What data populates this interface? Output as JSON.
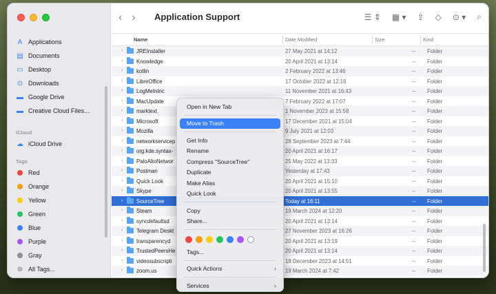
{
  "window": {
    "title": "Application Support"
  },
  "sidebar": {
    "favorites": [
      {
        "label": "Applications",
        "icon": "applications-icon"
      },
      {
        "label": "Documents",
        "icon": "document-icon"
      },
      {
        "label": "Desktop",
        "icon": "desktop-icon"
      },
      {
        "label": "Downloads",
        "icon": "downloads-icon"
      },
      {
        "label": "Google Drive",
        "icon": "folder-icon"
      },
      {
        "label": "Creative Cloud Files...",
        "icon": "folder-icon"
      }
    ],
    "icloud_heading": "iCloud",
    "icloud": [
      {
        "label": "iCloud Drive",
        "icon": "cloud-icon"
      }
    ],
    "tags_heading": "Tags",
    "tags": [
      {
        "label": "Red",
        "color": "#ef4444"
      },
      {
        "label": "Orange",
        "color": "#f59e0b"
      },
      {
        "label": "Yellow",
        "color": "#facc15"
      },
      {
        "label": "Green",
        "color": "#22c55e"
      },
      {
        "label": "Blue",
        "color": "#3b82f6"
      },
      {
        "label": "Purple",
        "color": "#a855f7"
      },
      {
        "label": "Gray",
        "color": "#8e8e93"
      },
      {
        "label": "All Tags...",
        "color": ""
      }
    ]
  },
  "columns": {
    "name": "Name",
    "date": "Date Modified",
    "size": "Size",
    "kind": "Kind"
  },
  "rows": [
    {
      "name": "JREInstaller",
      "date": "27 May 2021 at 14:12",
      "size": "--",
      "kind": "Folder"
    },
    {
      "name": "Knowledge",
      "date": "20 April 2021 at 13:14",
      "size": "--",
      "kind": "Folder"
    },
    {
      "name": "kotlin",
      "date": "2 February 2022 at 13:46",
      "size": "--",
      "kind": "Folder"
    },
    {
      "name": "LibreOffice",
      "date": "17 October 2022 at 12:16",
      "size": "--",
      "kind": "Folder"
    },
    {
      "name": "LogMeInInc",
      "date": "11 November 2021 at 16:43",
      "size": "--",
      "kind": "Folder"
    },
    {
      "name": "MacUpdate",
      "date": "7 February 2022 at 17:07",
      "size": "--",
      "kind": "Folder"
    },
    {
      "name": "marktext",
      "date": "1 November 2023 at 15:58",
      "size": "--",
      "kind": "Folder"
    },
    {
      "name": "Microsoft",
      "date": "17 December 2021 at 15:04",
      "size": "--",
      "kind": "Folder"
    },
    {
      "name": "Mozilla",
      "date": "9 July 2021 at 12:03",
      "size": "--",
      "kind": "Folder"
    },
    {
      "name": "networkservicep",
      "date": "28 September 2023 at 7:44",
      "size": "--",
      "kind": "Folder"
    },
    {
      "name": "org.kde.syntax-",
      "date": "20 April 2021 at 16:17",
      "size": "--",
      "kind": "Folder"
    },
    {
      "name": "PaloAltoNetwor",
      "date": "25 May 2022 at 13:33",
      "size": "--",
      "kind": "Folder"
    },
    {
      "name": "Postman",
      "date": "Yesterday at 17:43",
      "size": "--",
      "kind": "Folder"
    },
    {
      "name": "Quick Look",
      "date": "20 April 2021 at 15:10",
      "size": "--",
      "kind": "Folder"
    },
    {
      "name": "Skype",
      "date": "20 April 2021 at 13:55",
      "size": "--",
      "kind": "Folder"
    },
    {
      "name": "SourceTree",
      "date": "Today at 16:11",
      "size": "--",
      "kind": "Folder",
      "selected": true
    },
    {
      "name": "Steam",
      "date": "19 March 2024 at 12:20",
      "size": "--",
      "kind": "Folder"
    },
    {
      "name": "syncdefaultsd",
      "date": "20 April 2021 at 13:14",
      "size": "--",
      "kind": "Folder"
    },
    {
      "name": "Telegram Deskt",
      "date": "27 November 2023 at 16:26",
      "size": "--",
      "kind": "Folder"
    },
    {
      "name": "transparencyd",
      "date": "20 April 2021 at 13:19",
      "size": "--",
      "kind": "Folder"
    },
    {
      "name": "TrustedPeersHe",
      "date": "20 April 2021 at 13:14",
      "size": "--",
      "kind": "Folder"
    },
    {
      "name": "videosubscripti",
      "date": "18 December 2023 at 14:51",
      "size": "--",
      "kind": "Folder"
    },
    {
      "name": "zoom.us",
      "date": "19 March 2024 at 7:42",
      "size": "--",
      "kind": "Folder"
    }
  ],
  "menu": {
    "open_new_tab": "Open in New Tab",
    "move_to_trash": "Move to Trash",
    "get_info": "Get Info",
    "rename": "Rename",
    "compress": "Compress \"SourceTree\"",
    "duplicate": "Duplicate",
    "make_alias": "Make Alias",
    "quick_look": "Quick Look",
    "copy": "Copy",
    "share": "Share...",
    "tag_colors": [
      "#ef4444",
      "#f59e0b",
      "#facc15",
      "#22c55e",
      "#3b82f6",
      "#a855f7",
      "#ffffff"
    ],
    "tags": "Tags...",
    "quick_actions": "Quick Actions",
    "services": "Services"
  }
}
